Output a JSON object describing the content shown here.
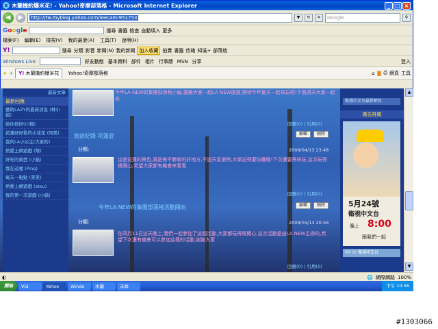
{
  "window": {
    "title": "木蘭機約爆米花! - Yahoo!奇摩部落格 - Microsoft Internet Explorer",
    "icon": "ie-icon"
  },
  "address": {
    "url": "http://tw.myblog.yahoo.com/leecam-951753",
    "search_placeholder": "Google"
  },
  "google_bar": {
    "logo": [
      "G",
      "o",
      "o",
      "g",
      "l",
      "e"
    ],
    "items": [
      "搜尋",
      "書籤",
      "檢查",
      "自動填入",
      "更多"
    ]
  },
  "menu": [
    "檔案(F)",
    "編輯(E)",
    "檢視(V)",
    "我的最愛(A)",
    "工具(T)",
    "說明(H)"
  ],
  "yahoo_bar": {
    "logo": "Y!",
    "items": [
      "搜尋",
      "分類",
      "影音",
      "新聞(N)",
      "我的新聞",
      "拍賣",
      "書籤",
      "信箱",
      "知識+",
      "部落格"
    ],
    "highlight": "加入收藏"
  },
  "live_bar": {
    "logo": "Windows Live",
    "items": [
      "好友動態",
      "基本資料",
      "部件",
      "相片",
      "行事曆",
      "MSN",
      "分享"
    ],
    "signin": "登入"
  },
  "tabs": [
    {
      "label": "木蘭機約爆米花",
      "active": true
    },
    {
      "label": "Yahoo!奇摩部落格",
      "active": false
    }
  ],
  "toolbar_right": [
    "網頁",
    "工具"
  ],
  "left_col": {
    "top_link": "最新文章",
    "head": "最新回應",
    "items": [
      "藝術LAZY的最新消息 (林小姐)",
      "給你很好(小猫)",
      "花蓮好好看的小花花 (阿美)",
      "我的LA小公主(大家的)",
      "熱愛上網遊戲 (陽)",
      "好吃的東西 (小猫)",
      "我在這裡 (Ping)",
      "每天一點點 (美美)",
      "熱愛上網遊戲 (atsu)",
      "我的第一次遊戲 (小貓)"
    ]
  },
  "right_col": {
    "head": "廣告推薦",
    "ad_top": "衛視中文台最新節目",
    "ad_date": "5月24號",
    "ad_channel": "衛視中文台",
    "ad_time_label": "晚上",
    "ad_time": "8:00",
    "ad_tagline": "跟我們一起",
    "ad_bottom": "MY V! 衛視中文台"
  },
  "posts": [
    {
      "intro": "今年LA NEW的集團部落格小編,要跟大家一起LA NEW旅遊,期待今年夏天一起來玩吧!下個週末大家一起去",
      "title": "",
      "category": "",
      "date": "",
      "links": "回應(0) | 引用(0)",
      "buttons": [
        "編輯",
        "刪除"
      ]
    },
    {
      "title": "旅遊紀錄 花蓮遊",
      "category": "分類:",
      "date": "2009/04/13 23:48",
      "text": "這是花蓮的景色,真是美不勝收的好地方,不過天氣很熱,大家記得要防曬喔!下次還要再來玩,這次玩得很開心,希望大家都有機會來看看",
      "links": "回應(0) | 引用(0)",
      "buttons": [
        "編輯",
        "刪除"
      ]
    },
    {
      "title": "今年LA NEW的集團部落格活動開始",
      "category": "分類:",
      "date": "2009/04/13 20:56",
      "text": "在四月11日這天晚上,我們一起參加了這個活動,大家都玩得很開心,這次活動是由LA NEW主辦的,希望下次還有機會可以參加這樣的活動,謝謝大家",
      "links": "回應(0) | 引用(0)",
      "buttons": [
        "編輯",
        "刪除"
      ]
    }
  ],
  "status": {
    "text": "網際網路",
    "zoom": "100%"
  },
  "taskbar": {
    "start": "開始",
    "tasks": [
      "Vid",
      "Yahoo",
      "Windo",
      "木蘭",
      "未命"
    ],
    "clock": "下午 10:56"
  },
  "watermark": "#1303066"
}
